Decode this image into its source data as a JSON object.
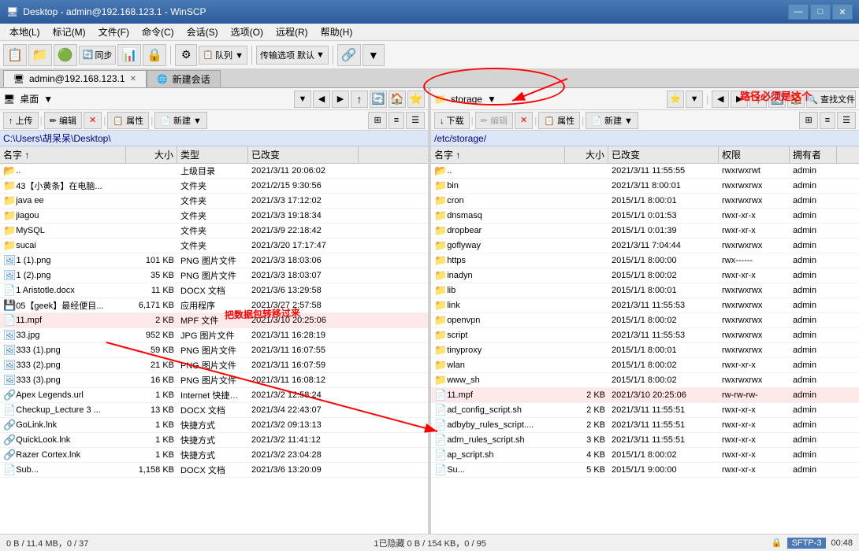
{
  "window": {
    "title": "Desktop - admin@192.168.123.1 - WinSCP",
    "title_icon": "📁"
  },
  "title_bar_controls": {
    "minimize": "—",
    "maximize": "□",
    "close": "✕"
  },
  "menu_bar": {
    "items": [
      {
        "label": "本地(L)",
        "id": "local"
      },
      {
        "label": "标记(M)",
        "id": "mark"
      },
      {
        "label": "文件(F)",
        "id": "file"
      },
      {
        "label": "命令(C)",
        "id": "command"
      },
      {
        "label": "会话(S)",
        "id": "session"
      },
      {
        "label": "选项(O)",
        "id": "options"
      },
      {
        "label": "远程(R)",
        "id": "remote"
      },
      {
        "label": "帮助(H)",
        "id": "help"
      }
    ]
  },
  "toolbar": {
    "sync_label": "同步",
    "queue_label": "队列 ▼",
    "transfer_label": "传输选项 默认",
    "new_session_label": "新建会话"
  },
  "tabs": {
    "items": [
      {
        "label": "admin@192.168.123.1",
        "active": true
      },
      {
        "label": "新建会话",
        "active": false
      }
    ]
  },
  "left_pane": {
    "path": "C:\\Users\\胡呆呆\\Desktop\\",
    "path_display": "C:\\Users\\胡呆呆\\Desktop\\",
    "columns": [
      {
        "label": "名字",
        "id": "name"
      },
      {
        "label": "大小",
        "id": "size"
      },
      {
        "label": "类型",
        "id": "type"
      },
      {
        "label": "已改变",
        "id": "modified"
      }
    ],
    "action_buttons": [
      {
        "label": "↑ 上传",
        "disabled": false
      },
      {
        "label": "✏ 编辑",
        "disabled": false
      },
      {
        "label": "✕",
        "disabled": false
      },
      {
        "label": "属性",
        "disabled": false
      },
      {
        "label": "新建 ▼",
        "disabled": false
      }
    ],
    "files": [
      {
        "name": "..",
        "size": "",
        "type": "上级目录",
        "modified": "2021/3/11  20:06:02",
        "icon": "up"
      },
      {
        "name": "43【小黄条】在电脑...",
        "size": "",
        "type": "文件夹",
        "modified": "2021/2/15   9:30:56",
        "icon": "folder"
      },
      {
        "name": "java ee",
        "size": "",
        "type": "文件夹",
        "modified": "2021/3/3  17:12:02",
        "icon": "folder"
      },
      {
        "name": "jiagou",
        "size": "",
        "type": "文件夹",
        "modified": "2021/3/3  19:18:34",
        "icon": "folder"
      },
      {
        "name": "MySQL",
        "size": "",
        "type": "文件夹",
        "modified": "2021/3/9  22:18:42",
        "icon": "folder"
      },
      {
        "name": "sucai",
        "size": "",
        "type": "文件夹",
        "modified": "2021/3/20  17:17:47",
        "icon": "folder"
      },
      {
        "name": "1 (1).png",
        "size": "101 KB",
        "type": "PNG 图片文件",
        "modified": "2021/3/3  18:03:06",
        "icon": "image"
      },
      {
        "name": "1 (2).png",
        "size": "35 KB",
        "type": "PNG 图片文件",
        "modified": "2021/3/3  18:03:07",
        "icon": "image"
      },
      {
        "name": "1 Aristotle.docx",
        "size": "11 KB",
        "type": "DOCX 文档",
        "modified": "2021/3/6  13:29:58",
        "icon": "doc"
      },
      {
        "name": "05【geek】最经便目...",
        "size": "6,171 KB",
        "type": "应用程序",
        "modified": "2021/3/27  2:57:58",
        "icon": "app"
      },
      {
        "name": "11.mpf",
        "size": "2 KB",
        "type": "MPF 文件",
        "modified": "2021/3/10  20:25:06",
        "icon": "file",
        "selected": true
      },
      {
        "name": "33.jpg",
        "size": "952 KB",
        "type": "JPG 图片文件",
        "modified": "2021/3/11  16:28:19",
        "icon": "image"
      },
      {
        "name": "333 (1).png",
        "size": "59 KB",
        "type": "PNG 图片文件",
        "modified": "2021/3/11  16:07:55",
        "icon": "image"
      },
      {
        "name": "333 (2).png",
        "size": "21 KB",
        "type": "PNG 图片文件",
        "modified": "2021/3/11  16:07:59",
        "icon": "image"
      },
      {
        "name": "333 (3).png",
        "size": "16 KB",
        "type": "PNG 图片文件",
        "modified": "2021/3/11  16:08:12",
        "icon": "image"
      },
      {
        "name": "Apex Legends.url",
        "size": "1 KB",
        "type": "Internet 快捷方式",
        "modified": "2021/3/2  12:58:24",
        "icon": "link"
      },
      {
        "name": "Checkup_Lecture 3 ...",
        "size": "13 KB",
        "type": "DOCX 文档",
        "modified": "2021/3/4  22:43:07",
        "icon": "doc"
      },
      {
        "name": "GoLink.lnk",
        "size": "1 KB",
        "type": "快捷方式",
        "modified": "2021/3/2  09:13:13",
        "icon": "link"
      },
      {
        "name": "QuickLook.lnk",
        "size": "1 KB",
        "type": "快捷方式",
        "modified": "2021/3/2  11:41:12",
        "icon": "link"
      },
      {
        "name": "Razer Cortex.lnk",
        "size": "1 KB",
        "type": "快捷方式",
        "modified": "2021/3/2  23:04:28",
        "icon": "link"
      },
      {
        "name": "Sub...",
        "size": "1,158 KB",
        "type": "DOCX 文档",
        "modified": "2021/3/6  13:20:09",
        "icon": "doc"
      }
    ],
    "status": "0 B / 11.4 MB，0 / 37"
  },
  "right_pane": {
    "path": "storage",
    "path_display": "/etc/storage/",
    "annotation": "路径必须是这个",
    "columns": [
      {
        "label": "名字",
        "id": "name"
      },
      {
        "label": "大小",
        "id": "size"
      },
      {
        "label": "已改变",
        "id": "modified"
      },
      {
        "label": "权限",
        "id": "perm"
      },
      {
        "label": "拥有者",
        "id": "owner"
      }
    ],
    "action_buttons": [
      {
        "label": "↓ 下载",
        "disabled": false
      },
      {
        "label": "✏ 编辑",
        "disabled": true
      },
      {
        "label": "✕",
        "disabled": false
      },
      {
        "label": "属性",
        "disabled": false
      },
      {
        "label": "新建 ▼",
        "disabled": false
      }
    ],
    "files": [
      {
        "name": "..",
        "size": "",
        "modified": "2021/3/11  11:55:55",
        "perm": "rwxrwxrwt",
        "owner": "admin",
        "icon": "up"
      },
      {
        "name": "bin",
        "size": "",
        "modified": "2021/3/11   8:00:01",
        "perm": "rwxrwxrwx",
        "owner": "admin",
        "icon": "folder"
      },
      {
        "name": "cron",
        "size": "",
        "modified": "2015/1/1   8:00:01",
        "perm": "rwxrwxrwx",
        "owner": "admin",
        "icon": "folder"
      },
      {
        "name": "dnsmasq",
        "size": "",
        "modified": "2015/1/1   0:01:53",
        "perm": "rwxr-xr-x",
        "owner": "admin",
        "icon": "folder"
      },
      {
        "name": "dropbear",
        "size": "",
        "modified": "2015/1/1   0:01:39",
        "perm": "rwxr-xr-x",
        "owner": "admin",
        "icon": "folder"
      },
      {
        "name": "goflyway",
        "size": "",
        "modified": "2021/3/11   7:04:44",
        "perm": "rwxrwxrwx",
        "owner": "admin",
        "icon": "folder"
      },
      {
        "name": "https",
        "size": "",
        "modified": "2015/1/1   8:00:00",
        "perm": "rwx------",
        "owner": "admin",
        "icon": "folder"
      },
      {
        "name": "inadyn",
        "size": "",
        "modified": "2015/1/1   8:00:02",
        "perm": "rwxr-xr-x",
        "owner": "admin",
        "icon": "folder"
      },
      {
        "name": "lib",
        "size": "",
        "modified": "2015/1/1   8:00:01",
        "perm": "rwxrwxrwx",
        "owner": "admin",
        "icon": "folder"
      },
      {
        "name": "link",
        "size": "",
        "modified": "2021/3/11  11:55:53",
        "perm": "rwxrwxrwx",
        "owner": "admin",
        "icon": "folder"
      },
      {
        "name": "openvpn",
        "size": "",
        "modified": "2015/1/1   8:00:02",
        "perm": "rwxrwxrwx",
        "owner": "admin",
        "icon": "folder"
      },
      {
        "name": "script",
        "size": "",
        "modified": "2021/3/11  11:55:53",
        "perm": "rwxrwxrwx",
        "owner": "admin",
        "icon": "folder"
      },
      {
        "name": "tinyproxy",
        "size": "",
        "modified": "2015/1/1   8:00:01",
        "perm": "rwxrwxrwx",
        "owner": "admin",
        "icon": "folder"
      },
      {
        "name": "wlan",
        "size": "",
        "modified": "2015/1/1   8:00:02",
        "perm": "rwxr-xr-x",
        "owner": "admin",
        "icon": "folder"
      },
      {
        "name": "www_sh",
        "size": "",
        "modified": "2015/1/1   8:00:02",
        "perm": "rwxrwxrwx",
        "owner": "admin",
        "icon": "folder"
      },
      {
        "name": "11.mpf",
        "size": "2 KB",
        "modified": "2021/3/10  20:25:06",
        "perm": "rw-rw-rw-",
        "owner": "admin",
        "icon": "file",
        "selected": true
      },
      {
        "name": "ad_config_script.sh",
        "size": "2 KB",
        "modified": "2021/3/11  11:55:51",
        "perm": "rwxr-xr-x",
        "owner": "admin",
        "icon": "file"
      },
      {
        "name": "adbyby_rules_script....",
        "size": "2 KB",
        "modified": "2021/3/11  11:55:51",
        "perm": "rwxr-xr-x",
        "owner": "admin",
        "icon": "file"
      },
      {
        "name": "adm_rules_script.sh",
        "size": "3 KB",
        "modified": "2021/3/11  11:55:51",
        "perm": "rwxr-xr-x",
        "owner": "admin",
        "icon": "file"
      },
      {
        "name": "ap_script.sh",
        "size": "4 KB",
        "modified": "2015/1/1   8:00:02",
        "perm": "rwxr-xr-x",
        "owner": "admin",
        "icon": "file"
      },
      {
        "name": "Su...",
        "size": "5 KB",
        "modified": "2015/1/1   9:00:00",
        "perm": "rwxr-xr-x",
        "owner": "admin",
        "icon": "file"
      }
    ],
    "status": "1已隐藏   0 B / 154 KB，0 / 95"
  },
  "status_bar": {
    "left_status": "0 B / 11.4 MB，0 / 37",
    "right_status": "1已隐藏   0 B / 154 KB，0 / 95",
    "session": "SFTP-3",
    "time": "00:48"
  },
  "annotations": {
    "path_note": "路径必须是这个",
    "transfer_note": "把数据包转移过来"
  }
}
